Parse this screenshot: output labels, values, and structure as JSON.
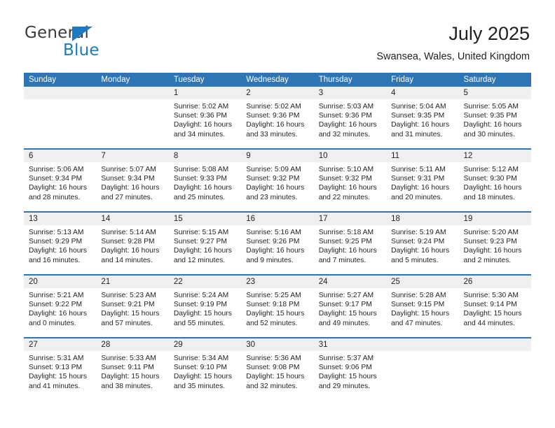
{
  "brand": {
    "name_top": "General",
    "name_bottom": "Blue"
  },
  "header": {
    "title": "July 2025",
    "subtitle": "Swansea, Wales, United Kingdom"
  },
  "calendar": {
    "weekdays": [
      "Sunday",
      "Monday",
      "Tuesday",
      "Wednesday",
      "Thursday",
      "Friday",
      "Saturday"
    ],
    "colors": {
      "header_blue": "#2e75b6",
      "day_band_gray": "#efefef",
      "text": "#231f20",
      "brand_blue": "#1b7ac4"
    },
    "labels": {
      "sunrise_prefix": "Sunrise:",
      "sunset_prefix": "Sunset:",
      "daylight_prefix": "Daylight:"
    },
    "weeks": [
      [
        {
          "day": "",
          "sunrise": "",
          "sunset": "",
          "daylight": ""
        },
        {
          "day": "",
          "sunrise": "",
          "sunset": "",
          "daylight": ""
        },
        {
          "day": "1",
          "sunrise": "Sunrise: 5:02 AM",
          "sunset": "Sunset: 9:36 PM",
          "daylight": "Daylight: 16 hours and 34 minutes."
        },
        {
          "day": "2",
          "sunrise": "Sunrise: 5:02 AM",
          "sunset": "Sunset: 9:36 PM",
          "daylight": "Daylight: 16 hours and 33 minutes."
        },
        {
          "day": "3",
          "sunrise": "Sunrise: 5:03 AM",
          "sunset": "Sunset: 9:36 PM",
          "daylight": "Daylight: 16 hours and 32 minutes."
        },
        {
          "day": "4",
          "sunrise": "Sunrise: 5:04 AM",
          "sunset": "Sunset: 9:35 PM",
          "daylight": "Daylight: 16 hours and 31 minutes."
        },
        {
          "day": "5",
          "sunrise": "Sunrise: 5:05 AM",
          "sunset": "Sunset: 9:35 PM",
          "daylight": "Daylight: 16 hours and 30 minutes."
        }
      ],
      [
        {
          "day": "6",
          "sunrise": "Sunrise: 5:06 AM",
          "sunset": "Sunset: 9:34 PM",
          "daylight": "Daylight: 16 hours and 28 minutes."
        },
        {
          "day": "7",
          "sunrise": "Sunrise: 5:07 AM",
          "sunset": "Sunset: 9:34 PM",
          "daylight": "Daylight: 16 hours and 27 minutes."
        },
        {
          "day": "8",
          "sunrise": "Sunrise: 5:08 AM",
          "sunset": "Sunset: 9:33 PM",
          "daylight": "Daylight: 16 hours and 25 minutes."
        },
        {
          "day": "9",
          "sunrise": "Sunrise: 5:09 AM",
          "sunset": "Sunset: 9:32 PM",
          "daylight": "Daylight: 16 hours and 23 minutes."
        },
        {
          "day": "10",
          "sunrise": "Sunrise: 5:10 AM",
          "sunset": "Sunset: 9:32 PM",
          "daylight": "Daylight: 16 hours and 22 minutes."
        },
        {
          "day": "11",
          "sunrise": "Sunrise: 5:11 AM",
          "sunset": "Sunset: 9:31 PM",
          "daylight": "Daylight: 16 hours and 20 minutes."
        },
        {
          "day": "12",
          "sunrise": "Sunrise: 5:12 AM",
          "sunset": "Sunset: 9:30 PM",
          "daylight": "Daylight: 16 hours and 18 minutes."
        }
      ],
      [
        {
          "day": "13",
          "sunrise": "Sunrise: 5:13 AM",
          "sunset": "Sunset: 9:29 PM",
          "daylight": "Daylight: 16 hours and 16 minutes."
        },
        {
          "day": "14",
          "sunrise": "Sunrise: 5:14 AM",
          "sunset": "Sunset: 9:28 PM",
          "daylight": "Daylight: 16 hours and 14 minutes."
        },
        {
          "day": "15",
          "sunrise": "Sunrise: 5:15 AM",
          "sunset": "Sunset: 9:27 PM",
          "daylight": "Daylight: 16 hours and 12 minutes."
        },
        {
          "day": "16",
          "sunrise": "Sunrise: 5:16 AM",
          "sunset": "Sunset: 9:26 PM",
          "daylight": "Daylight: 16 hours and 9 minutes."
        },
        {
          "day": "17",
          "sunrise": "Sunrise: 5:18 AM",
          "sunset": "Sunset: 9:25 PM",
          "daylight": "Daylight: 16 hours and 7 minutes."
        },
        {
          "day": "18",
          "sunrise": "Sunrise: 5:19 AM",
          "sunset": "Sunset: 9:24 PM",
          "daylight": "Daylight: 16 hours and 5 minutes."
        },
        {
          "day": "19",
          "sunrise": "Sunrise: 5:20 AM",
          "sunset": "Sunset: 9:23 PM",
          "daylight": "Daylight: 16 hours and 2 minutes."
        }
      ],
      [
        {
          "day": "20",
          "sunrise": "Sunrise: 5:21 AM",
          "sunset": "Sunset: 9:22 PM",
          "daylight": "Daylight: 16 hours and 0 minutes."
        },
        {
          "day": "21",
          "sunrise": "Sunrise: 5:23 AM",
          "sunset": "Sunset: 9:21 PM",
          "daylight": "Daylight: 15 hours and 57 minutes."
        },
        {
          "day": "22",
          "sunrise": "Sunrise: 5:24 AM",
          "sunset": "Sunset: 9:19 PM",
          "daylight": "Daylight: 15 hours and 55 minutes."
        },
        {
          "day": "23",
          "sunrise": "Sunrise: 5:25 AM",
          "sunset": "Sunset: 9:18 PM",
          "daylight": "Daylight: 15 hours and 52 minutes."
        },
        {
          "day": "24",
          "sunrise": "Sunrise: 5:27 AM",
          "sunset": "Sunset: 9:17 PM",
          "daylight": "Daylight: 15 hours and 49 minutes."
        },
        {
          "day": "25",
          "sunrise": "Sunrise: 5:28 AM",
          "sunset": "Sunset: 9:15 PM",
          "daylight": "Daylight: 15 hours and 47 minutes."
        },
        {
          "day": "26",
          "sunrise": "Sunrise: 5:30 AM",
          "sunset": "Sunset: 9:14 PM",
          "daylight": "Daylight: 15 hours and 44 minutes."
        }
      ],
      [
        {
          "day": "27",
          "sunrise": "Sunrise: 5:31 AM",
          "sunset": "Sunset: 9:13 PM",
          "daylight": "Daylight: 15 hours and 41 minutes."
        },
        {
          "day": "28",
          "sunrise": "Sunrise: 5:33 AM",
          "sunset": "Sunset: 9:11 PM",
          "daylight": "Daylight: 15 hours and 38 minutes."
        },
        {
          "day": "29",
          "sunrise": "Sunrise: 5:34 AM",
          "sunset": "Sunset: 9:10 PM",
          "daylight": "Daylight: 15 hours and 35 minutes."
        },
        {
          "day": "30",
          "sunrise": "Sunrise: 5:36 AM",
          "sunset": "Sunset: 9:08 PM",
          "daylight": "Daylight: 15 hours and 32 minutes."
        },
        {
          "day": "31",
          "sunrise": "Sunrise: 5:37 AM",
          "sunset": "Sunset: 9:06 PM",
          "daylight": "Daylight: 15 hours and 29 minutes."
        },
        {
          "day": "",
          "sunrise": "",
          "sunset": "",
          "daylight": ""
        },
        {
          "day": "",
          "sunrise": "",
          "sunset": "",
          "daylight": ""
        }
      ]
    ]
  }
}
